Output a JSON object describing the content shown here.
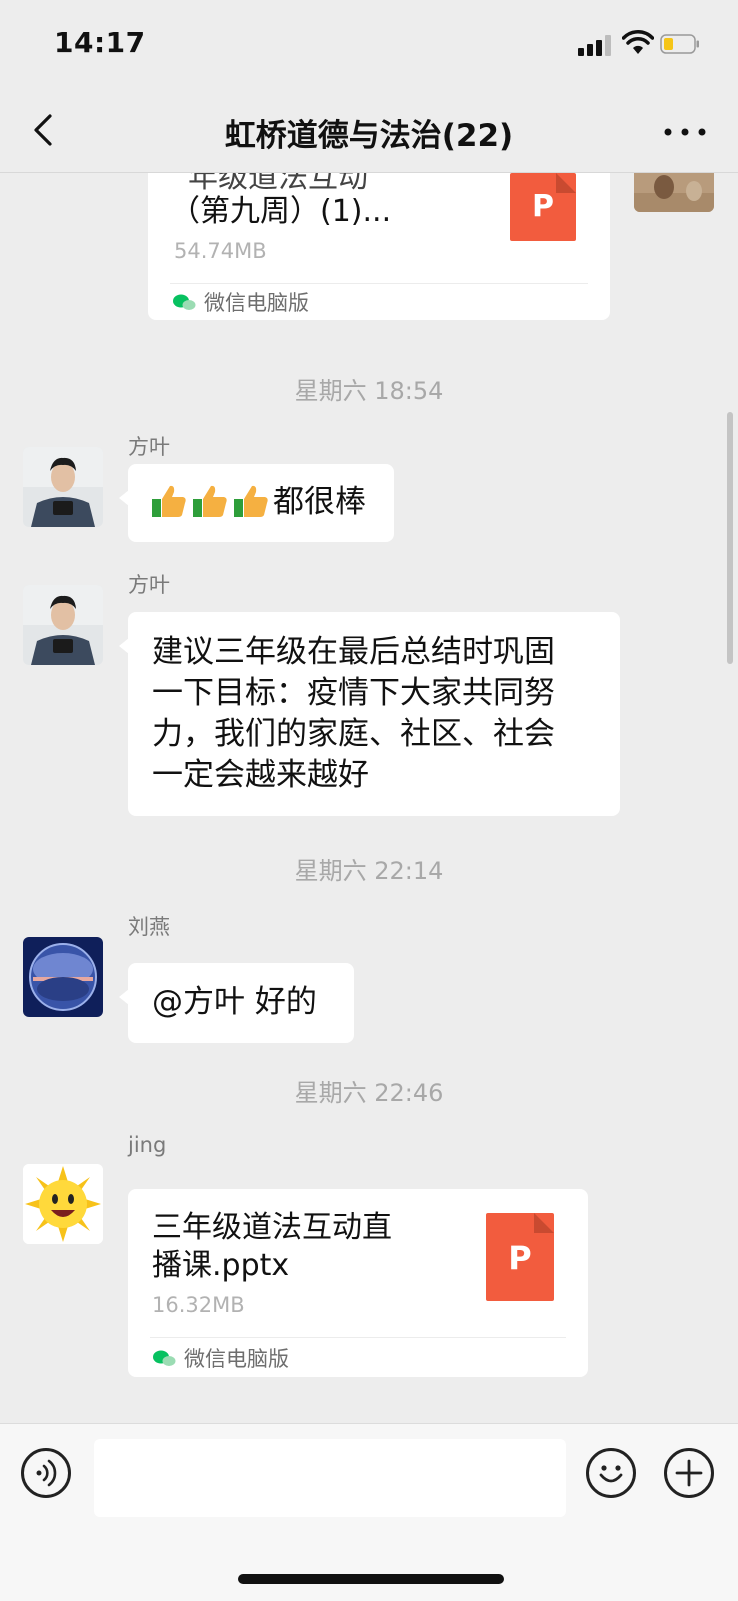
{
  "status_bar": {
    "time": "14:17"
  },
  "header": {
    "title": "虹桥道德与法治(22)"
  },
  "messages": {
    "top_file": {
      "name_line1": "年级道法互动",
      "name_line2": "（第九周）(1)...",
      "size": "54.74MB",
      "source": "微信电脑版",
      "icon_letter": "P"
    },
    "ts1": "星期六 18:54",
    "msg1": {
      "sender": "方叶",
      "text": "都很棒"
    },
    "msg2": {
      "sender": "方叶",
      "line1": "建议三年级在最后总结时巩固",
      "line2": "一下目标：疫情下大家共同努",
      "line3": "力，我们的家庭、社区、社会",
      "line4": "一定会越来越好"
    },
    "ts2": "星期六 22:14",
    "msg3": {
      "sender": "刘燕",
      "text": "@方叶 好的"
    },
    "ts3": "星期六 22:46",
    "msg4": {
      "sender": "jing",
      "name_line1": "三年级道法互动直",
      "name_line2": "播课.pptx",
      "size": "16.32MB",
      "source": "微信电脑版",
      "icon_letter": "P"
    }
  },
  "colors": {
    "background": "#ededed",
    "bubble": "#ffffff",
    "ppt_icon": "#f25c3e",
    "wechat_green": "#07c160"
  },
  "icons": {
    "back": "chevron-left-icon",
    "more": "more-icon",
    "voice": "voice-icon",
    "emoji": "emoji-icon",
    "add": "plus-icon"
  }
}
